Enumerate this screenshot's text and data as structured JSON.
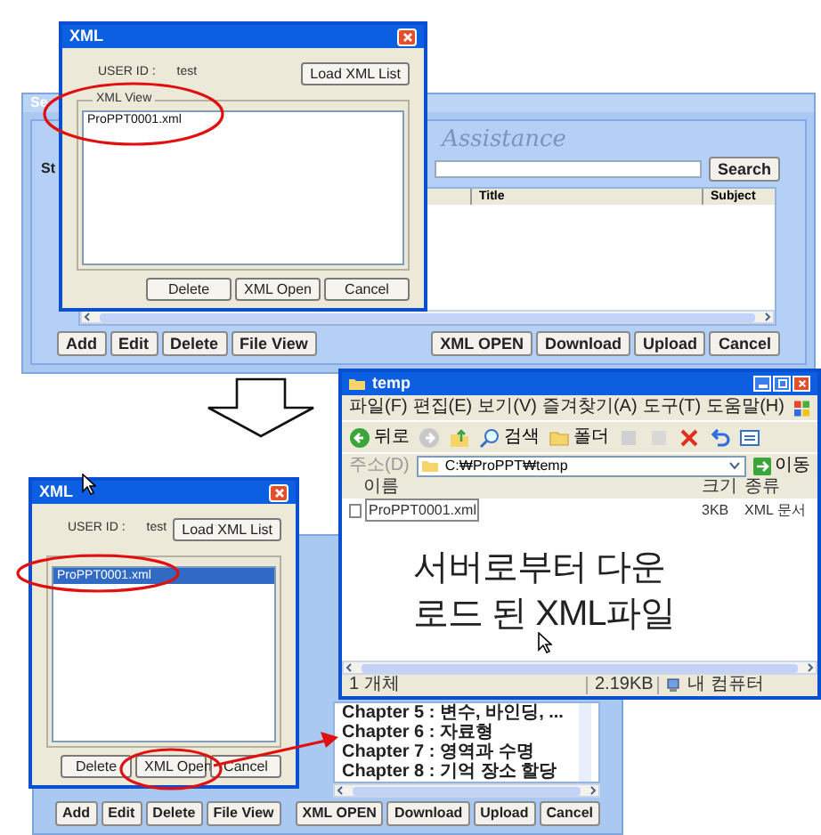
{
  "top": {
    "main_window": {
      "title": "Se",
      "search_label": "St",
      "banner": "Assistance",
      "search_button": "Search",
      "columns": [
        "Title",
        "Subject"
      ],
      "buttons_left": [
        "Add",
        "Edit",
        "Delete",
        "File View"
      ],
      "buttons_right": [
        "XML OPEN",
        "Download",
        "Upload",
        "Cancel"
      ]
    },
    "xml_dialog": {
      "title": "XML",
      "user_id_label": "USER ID :",
      "user_id": "test",
      "load_button": "Load XML List",
      "group_label": "XML View",
      "files": [
        {
          "name": "ProPPT0001.xml",
          "selected": false
        }
      ],
      "buttons": [
        "Delete",
        "XML Open",
        "Cancel"
      ]
    }
  },
  "bottom": {
    "main_window": {
      "chapters": [
        "Chapter 5 : 변수, 바인딩, ...",
        "Chapter 6 : 자료형",
        "Chapter 7 : 영역과 수명",
        "Chapter 8 : 기억 장소 할당"
      ],
      "buttons_left": [
        "Add",
        "Edit",
        "Delete",
        "File View"
      ],
      "buttons_right": [
        "XML OPEN",
        "Download",
        "Upload",
        "Cancel"
      ]
    },
    "xml_dialog": {
      "title": "XML",
      "user_id_label": "USER ID :",
      "user_id": "test",
      "load_button": "Load XML List",
      "files": [
        {
          "name": "ProPPT0001.xml",
          "selected": true
        }
      ],
      "buttons": [
        "Delete",
        "XML Open",
        "Cancel"
      ]
    },
    "explorer": {
      "title": "temp",
      "menu": [
        "파일(F)",
        "편집(E)",
        "보기(V)",
        "즐겨찾기(A)",
        "도구(T)",
        "도움말(H)"
      ],
      "back": "뒤로",
      "search": "검색",
      "folders": "폴더",
      "address_label": "주소(D)",
      "address": "C:₩ProPPT₩temp",
      "go": "이동",
      "columns": [
        "이름",
        "크기",
        "종류"
      ],
      "files": [
        {
          "name": "ProPPT0001.xml",
          "size": "3KB",
          "type": "XML 문서"
        }
      ],
      "status": [
        "1 개체",
        "2.19KB",
        "내 컴퓨터"
      ]
    },
    "caption": [
      "서버로부터 다운",
      "로드 된 XML파일"
    ]
  }
}
